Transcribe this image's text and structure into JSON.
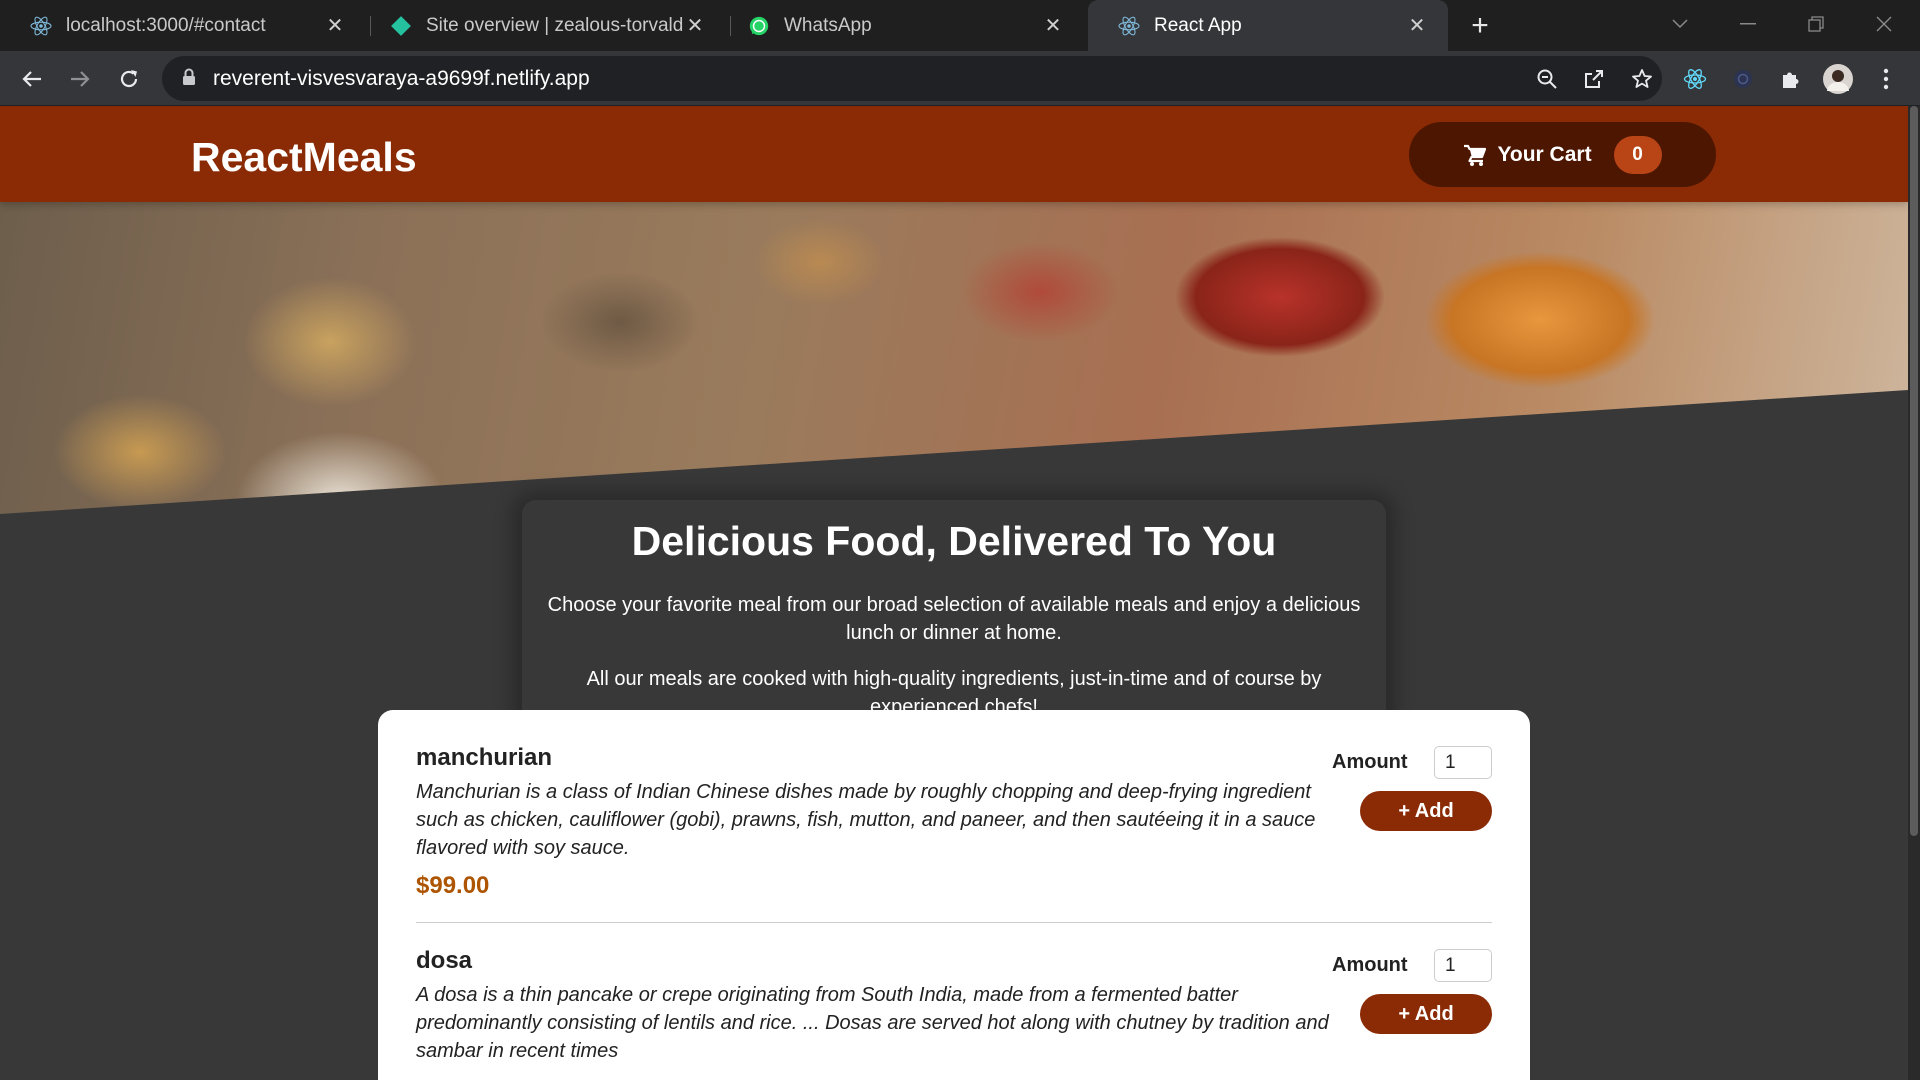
{
  "browser": {
    "tabs": [
      {
        "title": "localhost:3000/#contact",
        "icon": "react-icon",
        "active": false
      },
      {
        "title": "Site overview | zealous-torvalds-",
        "icon": "netlify-icon",
        "active": false
      },
      {
        "title": "WhatsApp",
        "icon": "whatsapp-icon",
        "active": false
      },
      {
        "title": "React App",
        "icon": "react-icon",
        "active": true
      }
    ],
    "url": "reverent-visvesvaraya-a9699f.netlify.app"
  },
  "header": {
    "brand": "ReactMeals",
    "cart_label": "Your Cart",
    "cart_count": "0"
  },
  "summary": {
    "title": "Delicious Food, Delivered To You",
    "paragraph1": "Choose your favorite meal from our broad selection of available meals and enjoy a delicious lunch or dinner at home.",
    "paragraph2": "All our meals are cooked with high-quality ingredients, just-in-time and of course by experienced chefs!"
  },
  "meals": [
    {
      "name": "manchurian",
      "description": "Manchurian is a class of Indian Chinese dishes made by roughly chopping and deep-frying ingredient such as chicken, cauliflower (gobi), prawns, fish, mutton, and paneer, and then sautéeing it in a sauce flavored with soy sauce.",
      "price": "$99.00",
      "amount_label": "Amount",
      "amount_value": "1",
      "add_label": "+ Add"
    },
    {
      "name": "dosa",
      "description": "A dosa is a thin pancake or crepe originating from South India, made from a fermented batter predominantly consisting of lentils and rice. ... Dosas are served hot along with chutney by tradition and sambar in recent times",
      "amount_label": "Amount",
      "amount_value": "1",
      "add_label": "+ Add"
    }
  ],
  "colors": {
    "header_bg": "#8a2b06",
    "cart_button_bg": "#4d1601",
    "cart_badge_bg": "#b94517",
    "page_bg": "#383838",
    "price": "#ad5502"
  }
}
